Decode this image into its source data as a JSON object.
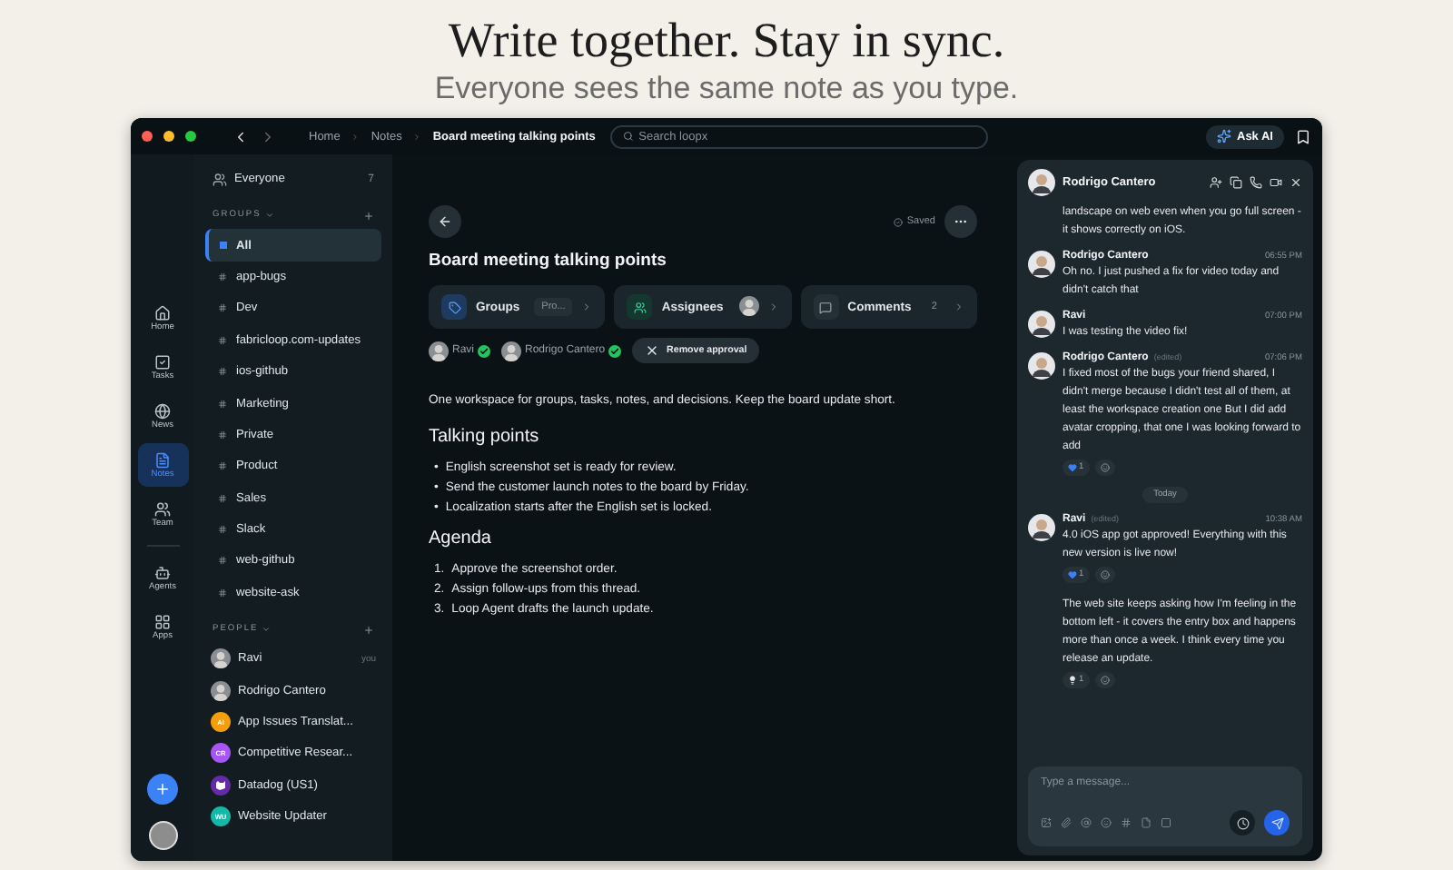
{
  "hero": {
    "title": "Write together. Stay in sync.",
    "subtitle": "Everyone sees the same note as you type."
  },
  "titlebar": {
    "breadcrumbs": [
      "Home",
      "Notes",
      "Board meeting talking points"
    ],
    "search": {
      "placeholder": "Search loopx"
    },
    "ask_ai": "Ask AI"
  },
  "rail": {
    "items": [
      {
        "kind": "home",
        "label": "Home",
        "selected": false
      },
      {
        "kind": "tasks",
        "label": "Tasks",
        "selected": false
      },
      {
        "kind": "news",
        "label": "News",
        "selected": false
      },
      {
        "kind": "notes",
        "label": "Notes",
        "selected": true
      },
      {
        "kind": "team",
        "label": "Team",
        "selected": false
      },
      {
        "kind": "agents",
        "label": "Agents",
        "selected": false
      },
      {
        "kind": "apps",
        "label": "Apps",
        "selected": false
      }
    ]
  },
  "sidebar": {
    "everyone": {
      "label": "Everyone",
      "count": "7"
    },
    "groups_heading": "GROUPS",
    "groups": [
      {
        "label": "All",
        "selected": true
      },
      {
        "label": "app-bugs",
        "selected": false
      },
      {
        "label": "Dev",
        "selected": false
      },
      {
        "label": "fabricloop.com-updates",
        "selected": false
      },
      {
        "label": "ios-github",
        "selected": false
      },
      {
        "label": "Marketing",
        "selected": false
      },
      {
        "label": "Private",
        "selected": false
      },
      {
        "label": "Product",
        "selected": false
      },
      {
        "label": "Sales",
        "selected": false
      },
      {
        "label": "Slack",
        "selected": false
      },
      {
        "label": "web-github",
        "selected": false
      },
      {
        "label": "website-ask",
        "selected": false
      }
    ],
    "people_heading": "PEOPLE",
    "people": [
      {
        "kind": "person",
        "name": "Ravi",
        "note": "you"
      },
      {
        "kind": "person",
        "name": "Rodrigo Cantero"
      },
      {
        "kind": "bot",
        "name": "App Issues Translat...",
        "initials": "AI",
        "color": "#f59e0b"
      },
      {
        "kind": "bot",
        "name": "Competitive Resear...",
        "initials": "CR",
        "color": "#a855f7"
      },
      {
        "kind": "logo",
        "name": "Datadog (US1)",
        "color": "#632ca6"
      },
      {
        "kind": "bot",
        "name": "Website Updater",
        "initials": "WU",
        "color": "#14b8a6"
      }
    ]
  },
  "note": {
    "saved": "Saved",
    "title": "Board meeting talking points",
    "chips": [
      {
        "kind": "groups",
        "label": "Groups",
        "value": "Pro..."
      },
      {
        "kind": "assignees",
        "label": "Assignees"
      },
      {
        "kind": "comments",
        "label": "Comments",
        "value": "2"
      }
    ],
    "approvals": [
      "Ravi",
      "Rodrigo Cantero"
    ],
    "remove_approval": "Remove approval",
    "intro": "One workspace for groups, tasks, notes, and decisions. Keep the board update short.",
    "sections": [
      {
        "heading": "Talking points",
        "items": [
          {
            "marker": "•",
            "text": "English screenshot set is ready for review."
          },
          {
            "marker": "•",
            "text": "Send the customer launch notes to the board by Friday."
          },
          {
            "marker": "•",
            "text": "Localization starts after the English set is locked."
          }
        ]
      },
      {
        "heading": "Agenda",
        "items": [
          {
            "marker": "1.",
            "text": "Approve the screenshot order."
          },
          {
            "marker": "2.",
            "text": "Assign follow-ups from this thread."
          },
          {
            "marker": "3.",
            "text": "Loop Agent drafts the launch update."
          }
        ]
      }
    ]
  },
  "chat": {
    "title": "Rodrigo Cantero",
    "messages": [
      {
        "text": "landscape on web even when you go full screen - it shows correctly on iOS."
      },
      {
        "author": "Rodrigo Cantero",
        "time": "06:55 PM",
        "text": "Oh no. I just pushed a fix for video today and didn't catch that"
      },
      {
        "author": "Ravi",
        "time": "07:00 PM",
        "text": "I was testing the video fix!"
      },
      {
        "author": "Rodrigo Cantero",
        "edited": "(edited)",
        "time": "07:06 PM",
        "text": "I fixed most of the bugs your friend shared, I didn't merge because I didn't test all of them, at least the workspace creation one But I did add avatar cropping, that one I was looking forward to add",
        "reactions": [
          {
            "kind": "heart",
            "count": "1"
          }
        ]
      },
      {
        "divider": "Today"
      },
      {
        "author": "Ravi",
        "edited": "(edited)",
        "time": "10:38 AM",
        "text": "4.0 iOS app got approved! Everything with this new version is live now!",
        "reactions": [
          {
            "kind": "heart",
            "count": "1"
          }
        ]
      },
      {
        "text": "The web site keeps asking how I'm feeling in the bottom left - it covers the entry box and happens more than once a week. I think every time you release an update.",
        "reactions": [
          {
            "kind": "bulb",
            "count": "1"
          }
        ]
      }
    ],
    "composer": {
      "placeholder": "Type a message..."
    }
  }
}
